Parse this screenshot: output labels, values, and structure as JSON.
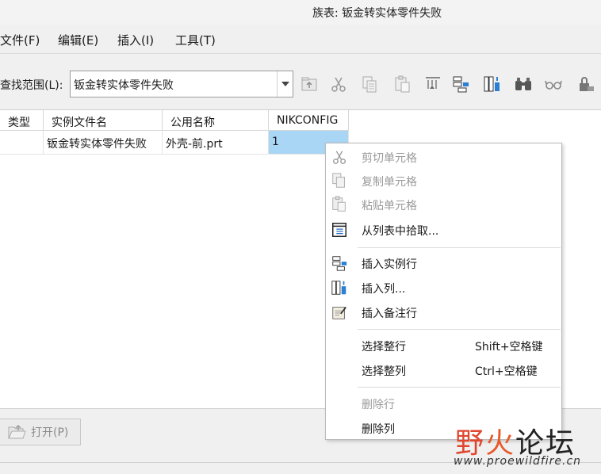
{
  "window": {
    "title": "族表: 钣金转实体零件失败"
  },
  "menubar": {
    "items": [
      "文件(F)",
      "编辑(E)",
      "插入(I)",
      "工具(T)"
    ]
  },
  "toolbar": {
    "search_label": "查找范围(L):",
    "search_value": "钣金转实体零件失败",
    "icons": [
      "up-folder-icon",
      "cut-icon",
      "copy-icon",
      "paste-icon",
      "insert-icon",
      "insert-row-icon",
      "insert-column-icon",
      "find-icon",
      "glasses-icon",
      "lock-icon"
    ]
  },
  "table": {
    "headers": [
      "类型",
      "实例文件名",
      "公用名称",
      "NIKCONFIG"
    ],
    "rows": [
      {
        "type": "",
        "instance": "钣金转实体零件失败",
        "common_name": "外壳-前.prt",
        "nikconfig": "1"
      }
    ]
  },
  "bottom": {
    "open_label": "打开(P)"
  },
  "context_menu": {
    "cut": "剪切单元格",
    "copy": "复制单元格",
    "paste": "粘贴单元格",
    "pick": "从列表中拾取...",
    "insert_row": "插入实例行",
    "insert_col": "插入列...",
    "insert_note": "插入备注行",
    "select_row": "选择整行",
    "select_row_shortcut": "Shift+空格键",
    "select_col": "选择整列",
    "select_col_shortcut": "Ctrl+空格键",
    "delete_row": "删除行",
    "delete_col": "删除列"
  },
  "watermark": {
    "c1": "野",
    "c2": "火",
    "c3": "论坛",
    "url": "www.proewildfire.cn"
  }
}
